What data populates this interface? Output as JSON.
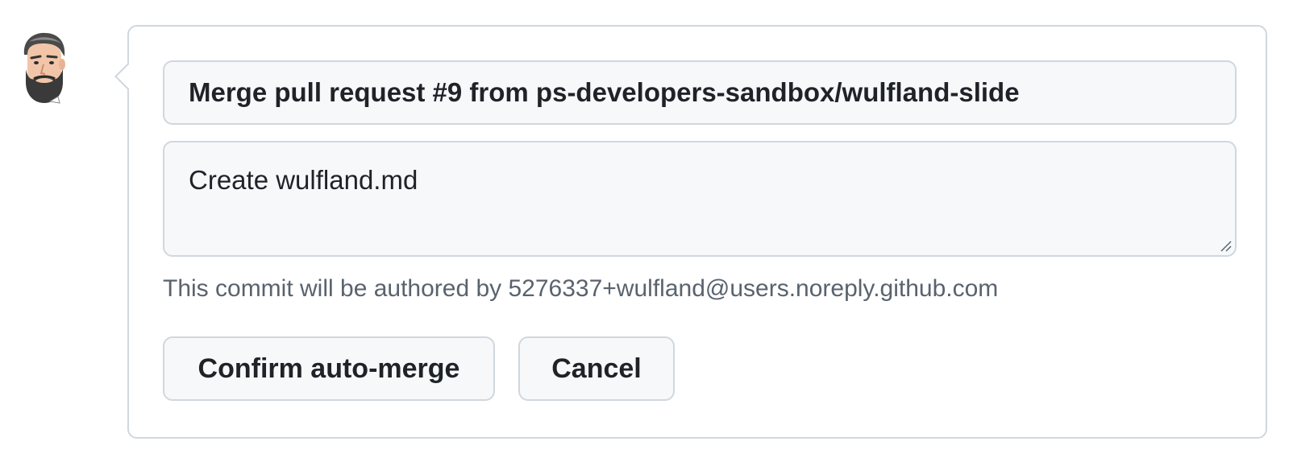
{
  "commit": {
    "title": "Merge pull request #9 from ps-developers-sandbox/wulfland-slide",
    "message": "Create wulfland.md",
    "author_note": "This commit will be authored by 5276337+wulfland@users.noreply.github.com"
  },
  "actions": {
    "confirm_label": "Confirm auto-merge",
    "cancel_label": "Cancel"
  },
  "icons": {
    "avatar": "user-avatar-bearded-man",
    "resize": "resize-handle-icon"
  },
  "colors": {
    "border": "#d0d7de",
    "field_bg": "#f6f8fa",
    "text": "#1f2328",
    "muted_text": "#59636e"
  }
}
